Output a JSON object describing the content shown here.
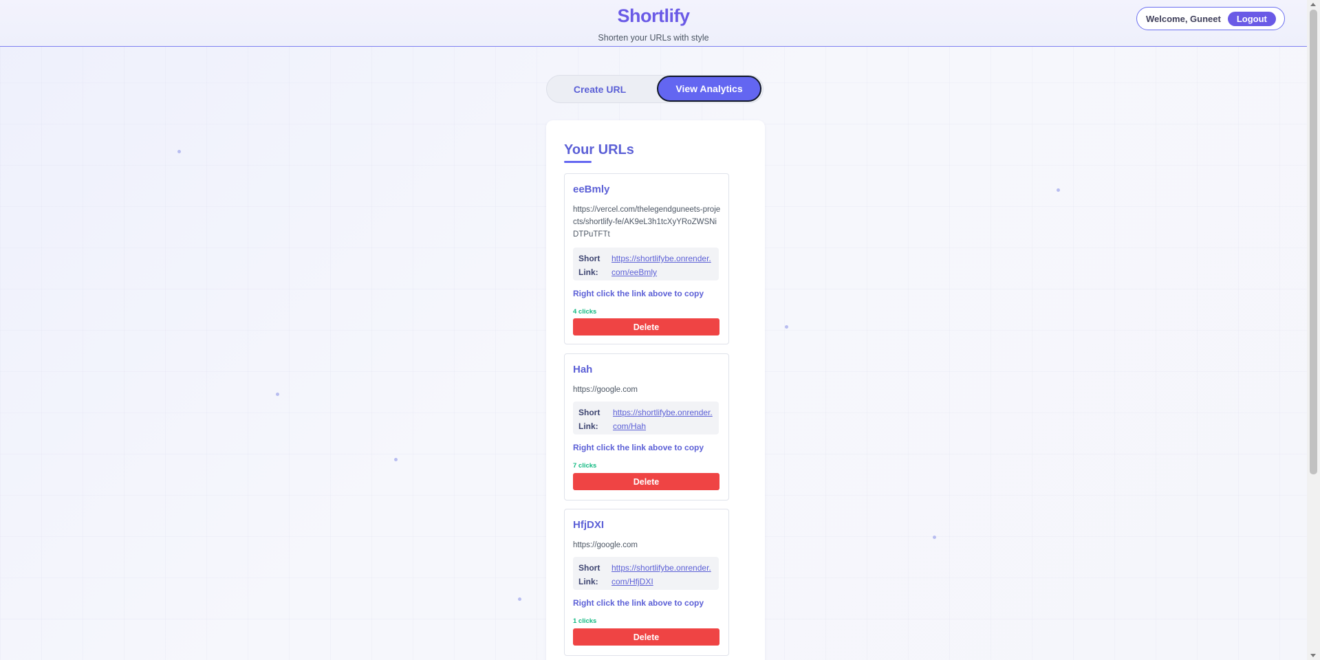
{
  "header": {
    "brand": "Shortlify",
    "tagline": "Shorten your URLs with style",
    "welcome": "Welcome, Guneet",
    "logout_label": "Logout"
  },
  "tabs": {
    "create_label": "Create URL",
    "analytics_label": "View Analytics",
    "active": "View Analytics"
  },
  "panel": {
    "title": "Your URLs"
  },
  "urls": [
    {
      "name": "eeBmly",
      "original": "https://vercel.com/thelegendguneets-projects/shortlify-fe/AK9eL3h1tcXyYRoZWSNiDTPuTFTt",
      "short_label": "Short Link:",
      "short_url": "https://shortlifybe.onrender.com/eeBmly",
      "copy_hint": "Right click the link above to copy",
      "clicks": "4 clicks",
      "delete_label": "Delete"
    },
    {
      "name": "Hah",
      "original": "https://google.com",
      "short_label": "Short Link:",
      "short_url": "https://shortlifybe.onrender.com/Hah",
      "copy_hint": "Right click the link above to copy",
      "clicks": "7 clicks",
      "delete_label": "Delete"
    },
    {
      "name": "HfjDXI",
      "original": "https://google.com",
      "short_label": "Short Link:",
      "short_url": "https://shortlifybe.onrender.com/HfjDXI",
      "copy_hint": "Right click the link above to copy",
      "clicks": "1 clicks",
      "delete_label": "Delete"
    }
  ],
  "colors": {
    "brand": "#6a5ae6",
    "accent": "#6366f1",
    "delete": "#ef4444",
    "clicks": "#10b981"
  }
}
